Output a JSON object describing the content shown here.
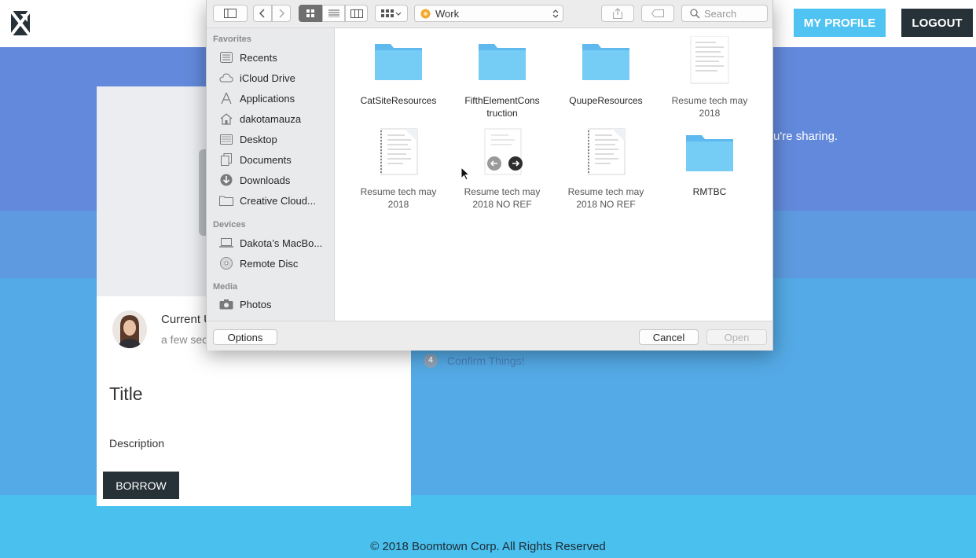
{
  "header": {
    "profile_button": "MY PROFILE",
    "logout_button": "LOGOUT"
  },
  "hero": {
    "partial_text": "u're sharing."
  },
  "card": {
    "user_name": "Current U",
    "timestamp": "a few sec",
    "title": "Title",
    "description": "Description",
    "borrow_button": "BORROW"
  },
  "steps": {
    "step4_number": "4",
    "step4_label": "Confirm Things!"
  },
  "footer": {
    "copyright": "© 2018 Boomtown Corp. All Rights Reserved"
  },
  "dialog": {
    "location": "Work",
    "search_placeholder": "Search",
    "sidebar": {
      "favorites_title": "Favorites",
      "favorites": [
        {
          "label": "Recents",
          "icon": "recents-icon"
        },
        {
          "label": "iCloud Drive",
          "icon": "cloud-icon"
        },
        {
          "label": "Applications",
          "icon": "applications-icon"
        },
        {
          "label": "dakotamauza",
          "icon": "home-icon"
        },
        {
          "label": "Desktop",
          "icon": "desktop-icon"
        },
        {
          "label": "Documents",
          "icon": "documents-icon"
        },
        {
          "label": "Downloads",
          "icon": "downloads-icon"
        },
        {
          "label": "Creative Cloud...",
          "icon": "folder-icon"
        }
      ],
      "devices_title": "Devices",
      "devices": [
        {
          "label": "Dakota’s MacBo...",
          "icon": "laptop-icon"
        },
        {
          "label": "Remote Disc",
          "icon": "disc-icon"
        }
      ],
      "media_title": "Media",
      "media": [
        {
          "label": "Photos",
          "icon": "camera-icon"
        }
      ]
    },
    "files": [
      {
        "line1": "CatSiteResources",
        "line2": "",
        "type": "folder"
      },
      {
        "line1": "FifthElementCons",
        "line2": "truction",
        "type": "folder"
      },
      {
        "line1": "QuupeResources",
        "line2": "",
        "type": "folder"
      },
      {
        "line1": "Resume tech may",
        "line2": "2018",
        "type": "document"
      },
      {
        "line1": "Resume tech may",
        "line2": "2018",
        "type": "document"
      },
      {
        "line1": "Resume tech may",
        "line2": "2018 NO REF",
        "type": "document"
      },
      {
        "line1": "Resume tech may",
        "line2": "2018 NO REF",
        "type": "document"
      },
      {
        "line1": "RMTBC",
        "line2": "",
        "type": "folder"
      }
    ],
    "options_button": "Options",
    "cancel_button": "Cancel",
    "open_button": "Open"
  },
  "colors": {
    "primary_dark": "#263238",
    "accent_blue": "#4fc3f2",
    "folder_blue": "#6ec8f4"
  }
}
